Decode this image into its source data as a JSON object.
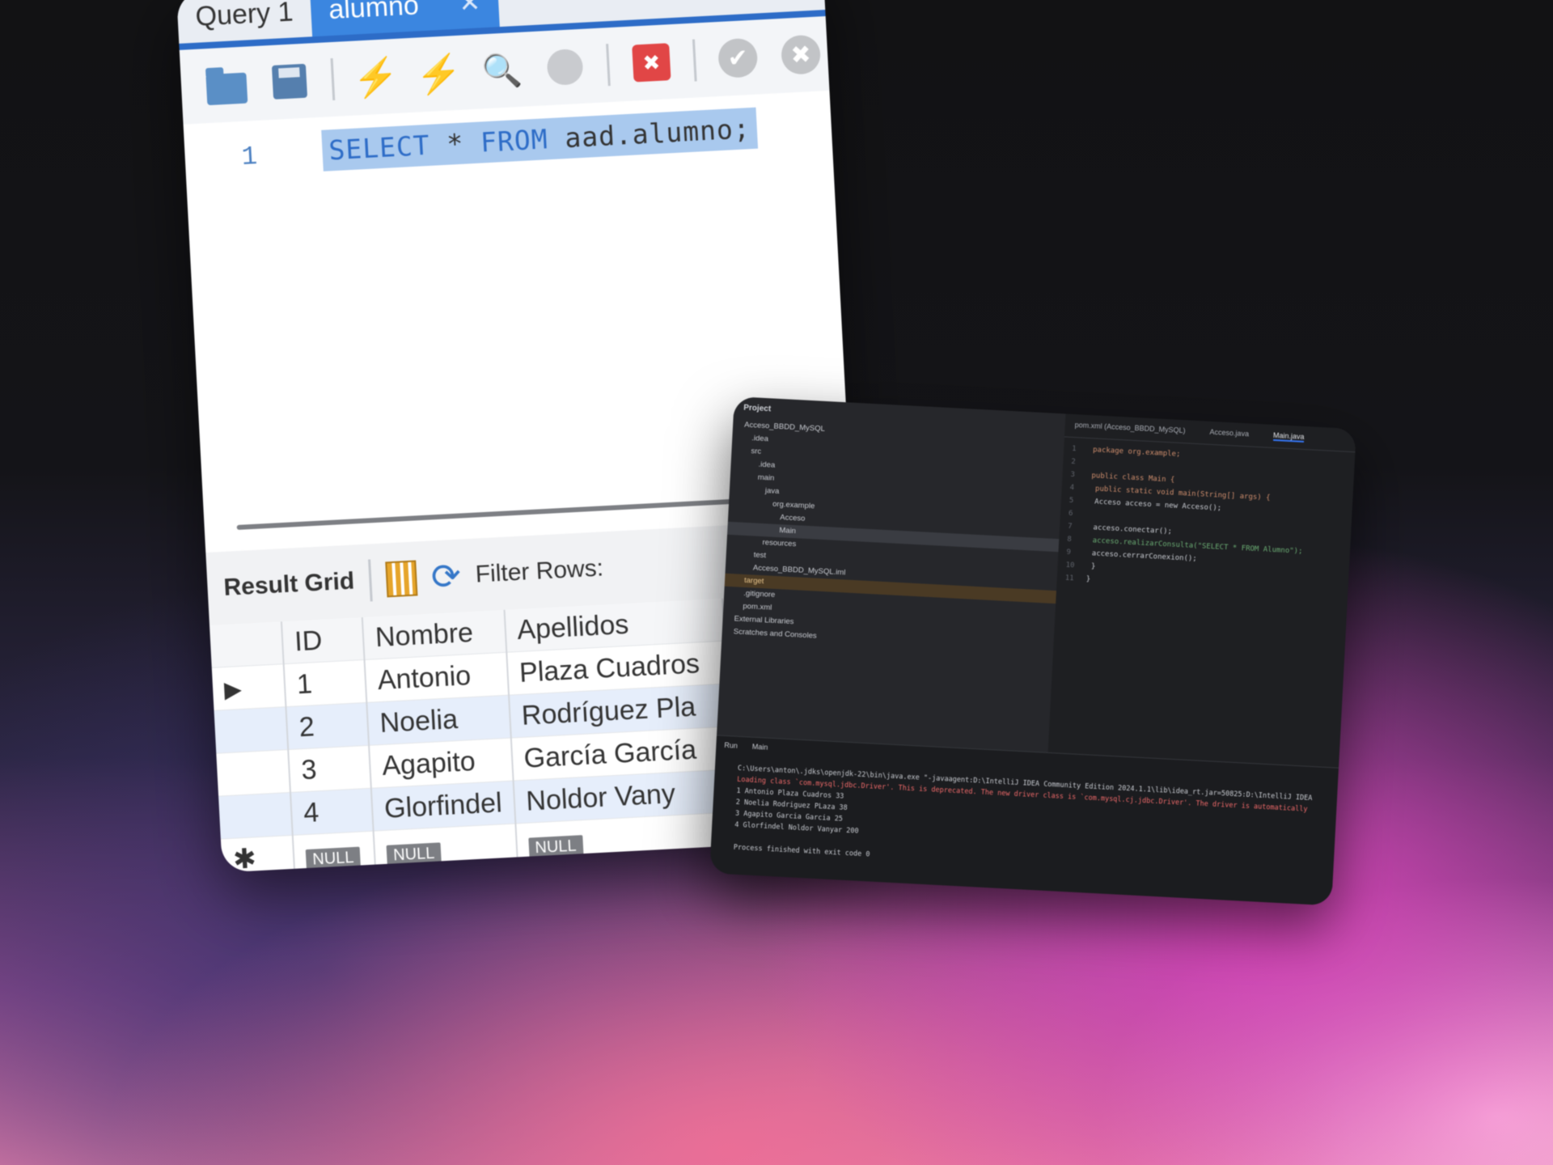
{
  "workbench": {
    "tabs": [
      "Query 1",
      "alumno"
    ],
    "tab_close": "✕",
    "line_number": "1",
    "sql": {
      "kw1": "SELECT",
      "star": "*",
      "kw2": "FROM",
      "ident": "aad.alumno;"
    },
    "result_grid_label": "Result Grid",
    "filter_label": "Filter Rows:",
    "columns": [
      "ID",
      "Nombre",
      "Apellidos"
    ],
    "rows": [
      {
        "id": "1",
        "nombre": "Antonio",
        "apellidos": "Plaza Cuadros"
      },
      {
        "id": "2",
        "nombre": "Noelia",
        "apellidos": "Rodríguez Pla"
      },
      {
        "id": "3",
        "nombre": "Agapito",
        "apellidos": "García García"
      },
      {
        "id": "4",
        "nombre": "Glorfindel",
        "apellidos": "Noldor Vany"
      }
    ],
    "null_label": "NULL",
    "row_arrow": "▶",
    "new_row_marker": "✱"
  },
  "ide": {
    "project_title": "Project",
    "tree": [
      {
        "label": "Acceso_BBDD_MySQL",
        "style": "root"
      },
      {
        "label": ".idea",
        "style": ""
      },
      {
        "label": "src",
        "style": ""
      },
      {
        "label": ".idea",
        "style": ""
      },
      {
        "label": "main",
        "style": ""
      },
      {
        "label": "java",
        "style": ""
      },
      {
        "label": "org.example",
        "style": ""
      },
      {
        "label": "Acceso",
        "style": ""
      },
      {
        "label": "Main",
        "style": "hl"
      },
      {
        "label": "resources",
        "style": ""
      },
      {
        "label": "test",
        "style": ""
      },
      {
        "label": "Acceso_BBDD_MySQL.iml",
        "style": ""
      },
      {
        "label": "target",
        "style": "tgt"
      },
      {
        "label": ".gitignore",
        "style": ""
      },
      {
        "label": "pom.xml",
        "style": ""
      },
      {
        "label": "External Libraries",
        "style": ""
      },
      {
        "label": "Scratches and Consoles",
        "style": ""
      }
    ],
    "editor_tabs": [
      "pom.xml (Acceso_BBDD_MySQL)",
      "Acceso.java",
      "Main.java"
    ],
    "code": [
      "package org.example;",
      "",
      "public class Main {",
      "    public static void main(String[] args) {",
      "        Acceso acceso = new Acceso();",
      "",
      "        acceso.conectar();",
      "        acceso.realizarConsulta(\"SELECT * FROM Alumno\");",
      "        acceso.cerrarConexion();",
      "    }",
      "}"
    ],
    "run_tabs": [
      "Run",
      "Main"
    ],
    "output": [
      {
        "text": "C:\\Users\\anton\\.jdks\\openjdk-22\\bin\\java.exe \"-javaagent:D:\\IntelliJ IDEA Community Edition 2024.1.1\\lib\\idea_rt.jar=50825:D:\\IntelliJ IDEA",
        "red": false
      },
      {
        "text": "Loading class `com.mysql.jdbc.Driver'. This is deprecated. The new driver class is `com.mysql.cj.jdbc.Driver'. The driver is automatically",
        "red": true
      },
      {
        "text": "1 Antonio Plaza Cuadros 33",
        "red": false
      },
      {
        "text": "2 Noelia Rodriguez PLaza 38",
        "red": false
      },
      {
        "text": "3 Agapito Garcia Garcia 25",
        "red": false
      },
      {
        "text": "4 Glorfindel Noldor Vanyar 200",
        "red": false
      },
      {
        "text": "",
        "red": false
      },
      {
        "text": "Process finished with exit code 0",
        "red": false
      }
    ]
  }
}
